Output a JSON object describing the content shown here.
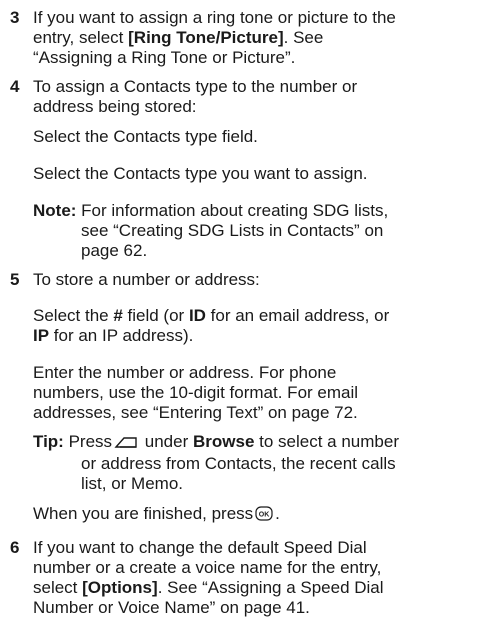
{
  "step3": {
    "number": "3",
    "line1": "If you want to assign a ring tone or picture to the",
    "line2_pre": "entry, select ",
    "line2_bold": "[Ring Tone/Picture]",
    "line2_post": ". See",
    "line3": "“Assigning a Ring Tone or Picture”."
  },
  "step4": {
    "number": "4",
    "line1": "To assign a Contacts type to the number or",
    "line2": "address being stored:",
    "para1": "Select the Contacts type field.",
    "para2": "Select the Contacts type you want to assign.",
    "note_label": "Note:",
    "note_line1": " For information about creating SDG lists,",
    "note_line2": "see “Creating SDG Lists in Contacts” on",
    "note_line3": "page 62."
  },
  "step5": {
    "number": "5",
    "line1": "To store a number or address:",
    "p1_a": "Select the ",
    "p1_b": "#",
    "p1_c": " field (or ",
    "p1_d": "ID",
    "p1_e": " for an email address, or",
    "p1_f": "IP",
    "p1_g": " for an IP address).",
    "p2_line1": "Enter the number or address. For phone",
    "p2_line2": "numbers, use the 10-digit format. For email",
    "p2_line3": "addresses, see “Entering Text” on page 72.",
    "tip_label": "Tip:",
    "tip_a": " Press",
    "tip_b": " under ",
    "tip_c": "Browse",
    "tip_d": " to select a number",
    "tip_line2": "or address from Contacts, the recent calls",
    "tip_line3": "list, or Memo.",
    "finish": "When you are finished, press",
    "finish_end": "."
  },
  "step6": {
    "number": "6",
    "line1": "If you want to change the default Speed Dial",
    "line2": "number or a create a voice name for the entry,",
    "line3_pre": "select ",
    "line3_bold": "[Options]",
    "line3_post": ". See “Assigning a Speed Dial",
    "line4": "Number or Voice Name” on page 41."
  },
  "icons": {
    "softkey": "left-softkey-icon",
    "ok": "ok-key-icon",
    "ok_label": "OK"
  }
}
